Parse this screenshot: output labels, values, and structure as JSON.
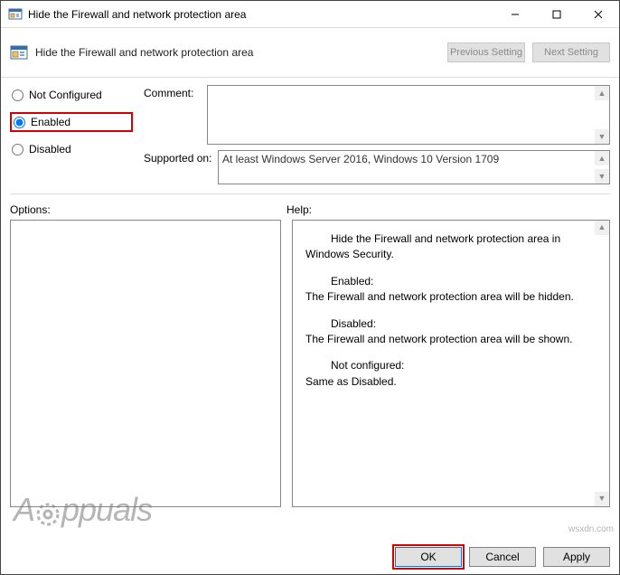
{
  "window": {
    "title": "Hide the Firewall and network protection area"
  },
  "header": {
    "title": "Hide the Firewall and network protection area",
    "prev": "Previous Setting",
    "next": "Next Setting"
  },
  "radios": {
    "notconfigured": "Not Configured",
    "enabled": "Enabled",
    "disabled": "Disabled"
  },
  "labels": {
    "comment": "Comment:",
    "supported": "Supported on:",
    "options": "Options:",
    "help": "Help:"
  },
  "supported_text": "At least Windows Server 2016, Windows 10 Version 1709",
  "help": {
    "p1": "Hide the Firewall and network protection area in Windows Security.",
    "p2a": "Enabled:",
    "p2b": "The Firewall and network protection area will be hidden.",
    "p3a": "Disabled:",
    "p3b": "The Firewall and network protection area will be shown.",
    "p4a": "Not configured:",
    "p4b": "Same as Disabled."
  },
  "buttons": {
    "ok": "OK",
    "cancel": "Cancel",
    "apply": "Apply"
  },
  "watermark": {
    "left": "A",
    "right": "ppuals",
    "corner": "wsxdn.com"
  }
}
